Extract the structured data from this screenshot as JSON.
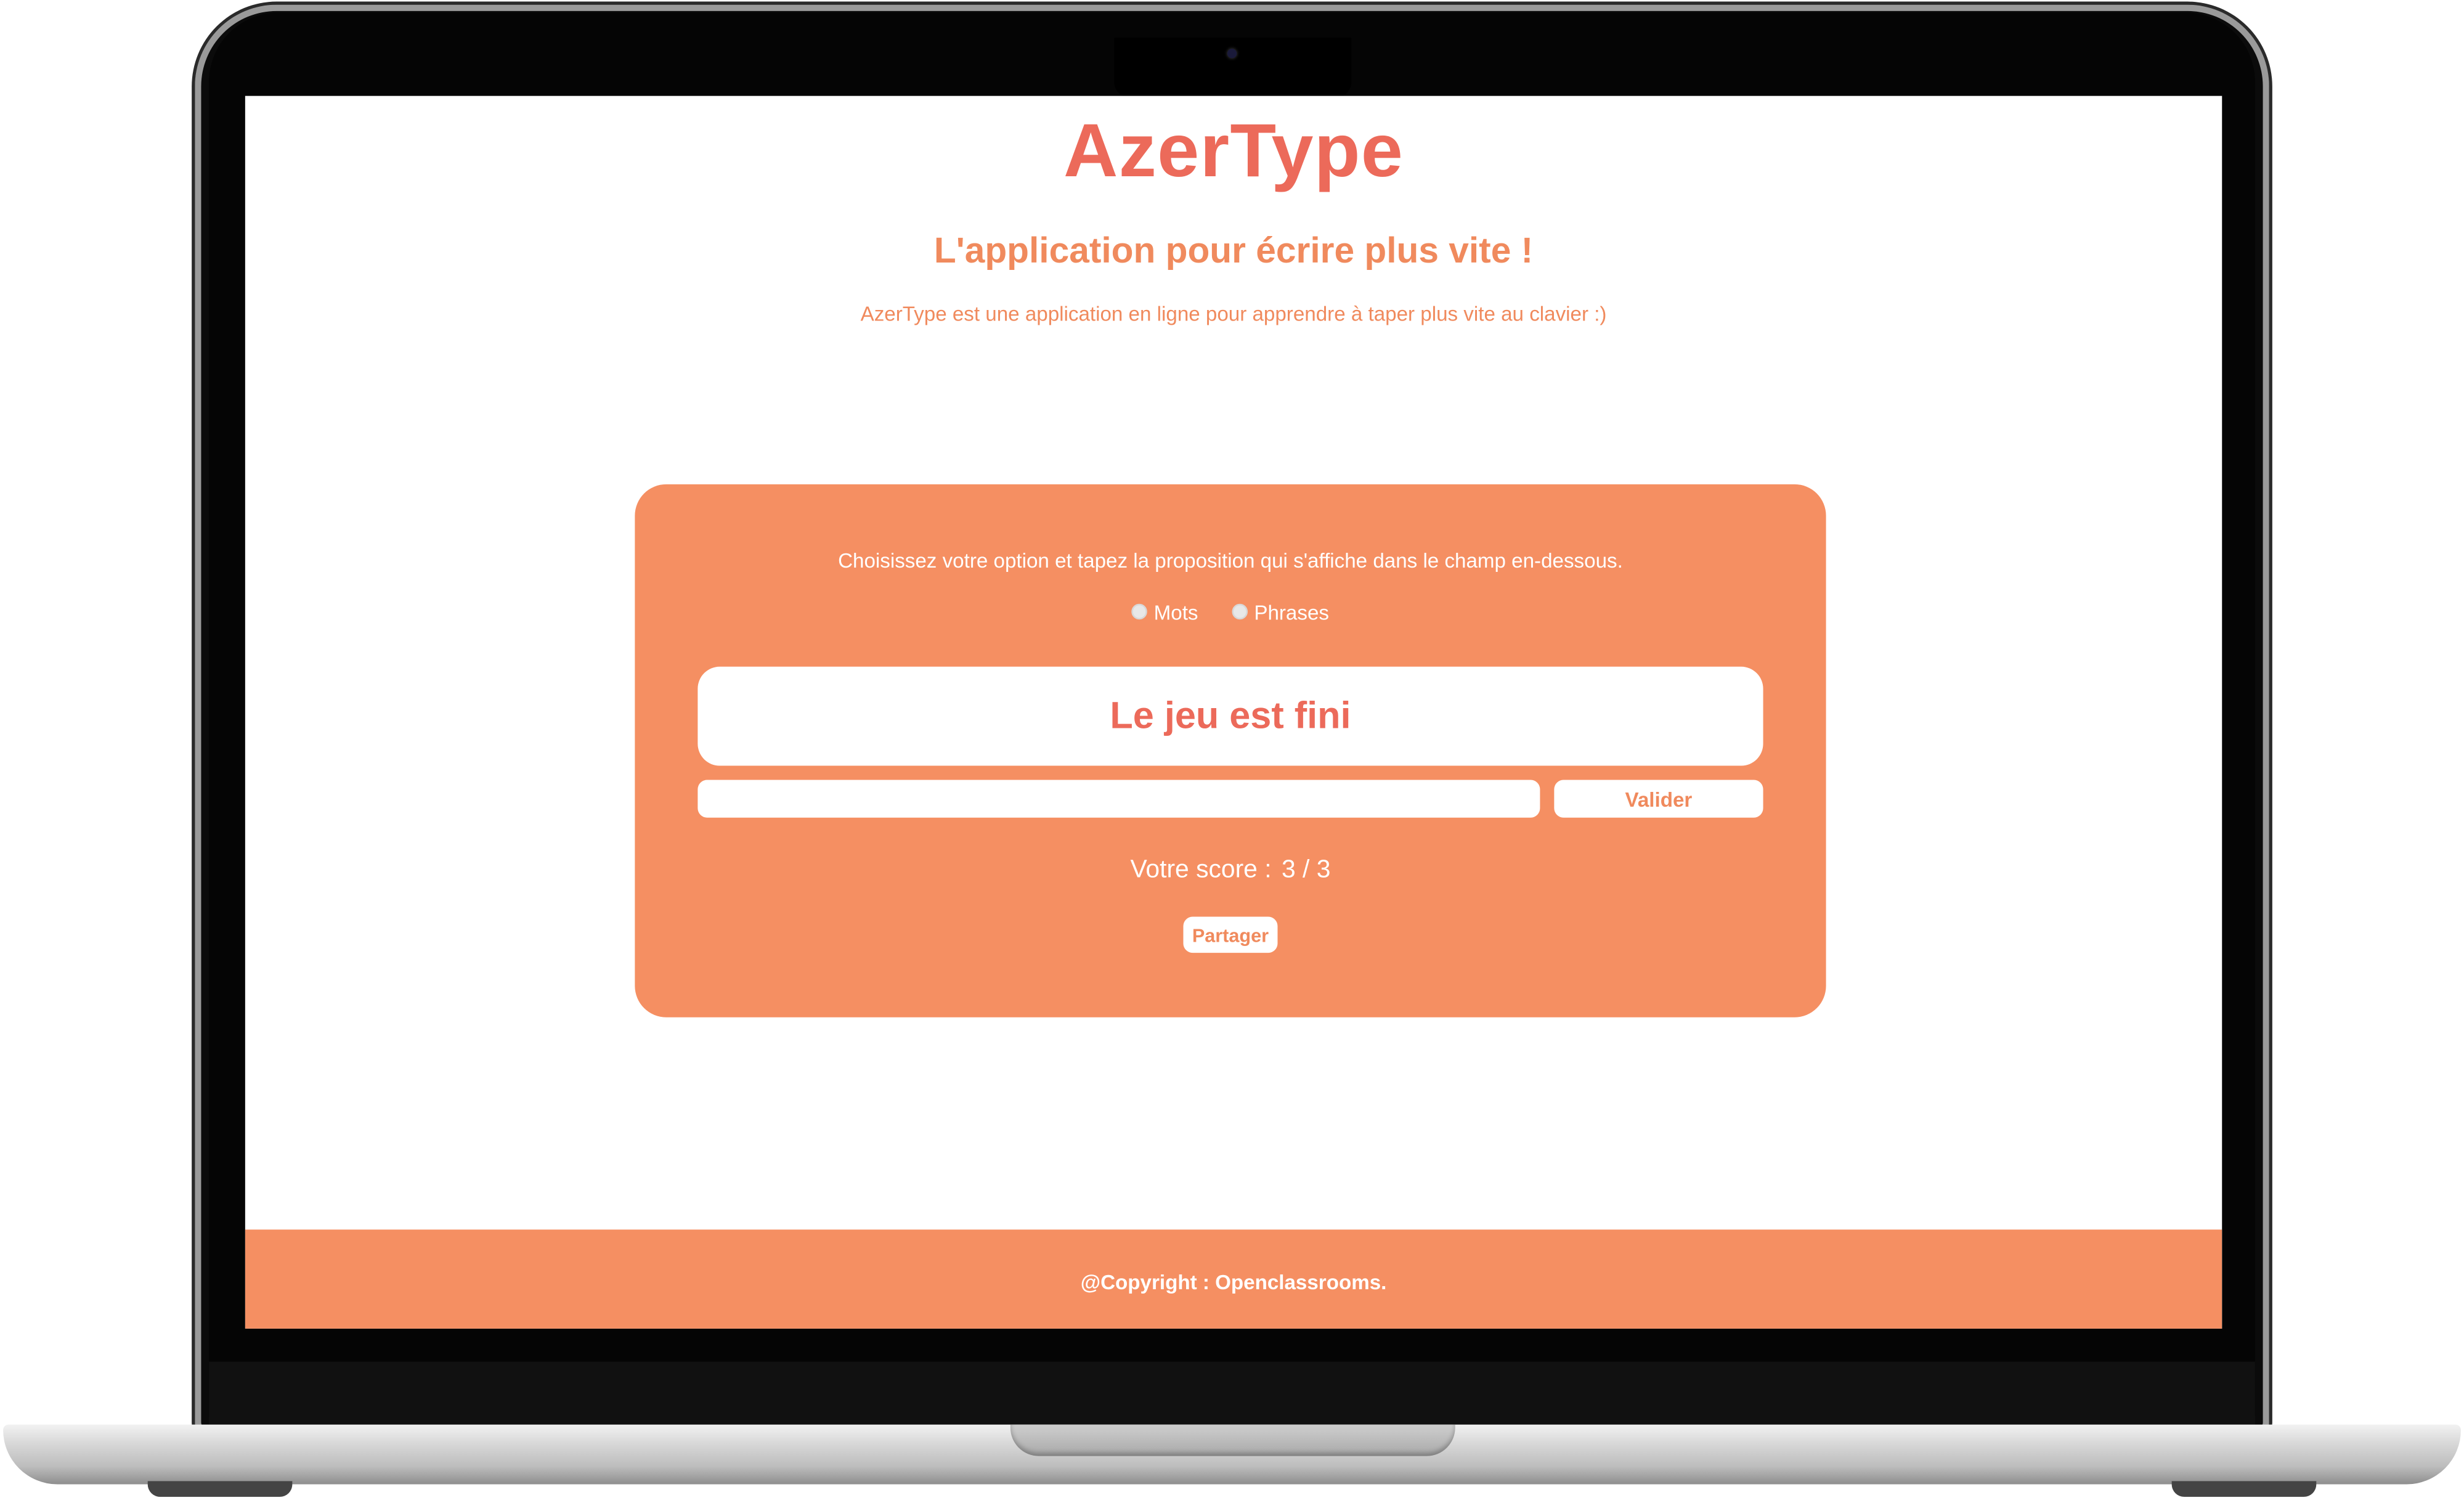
{
  "header": {
    "title": "AzerType",
    "subtitle": "L'application pour écrire plus vite !",
    "description": "AzerType est une application en ligne pour apprendre à taper plus vite au clavier :)"
  },
  "game": {
    "instructions": "Choisissez votre option et tapez la proposition qui s'affiche dans le champ en-dessous.",
    "options": [
      {
        "label": "Mots",
        "selected": false
      },
      {
        "label": "Phrases",
        "selected": false
      }
    ],
    "proposal": "Le jeu est fini",
    "input": {
      "value": "",
      "placeholder": ""
    },
    "validate_label": "Valider",
    "score_label": "Votre score :",
    "score_value": "3 / 3",
    "share_label": "Partager"
  },
  "footer": {
    "text": "@Copyright : Openclassrooms."
  },
  "colors": {
    "accent": "#f58f62",
    "title": "#ec6a5a",
    "text_on_accent": "#ffffff"
  }
}
